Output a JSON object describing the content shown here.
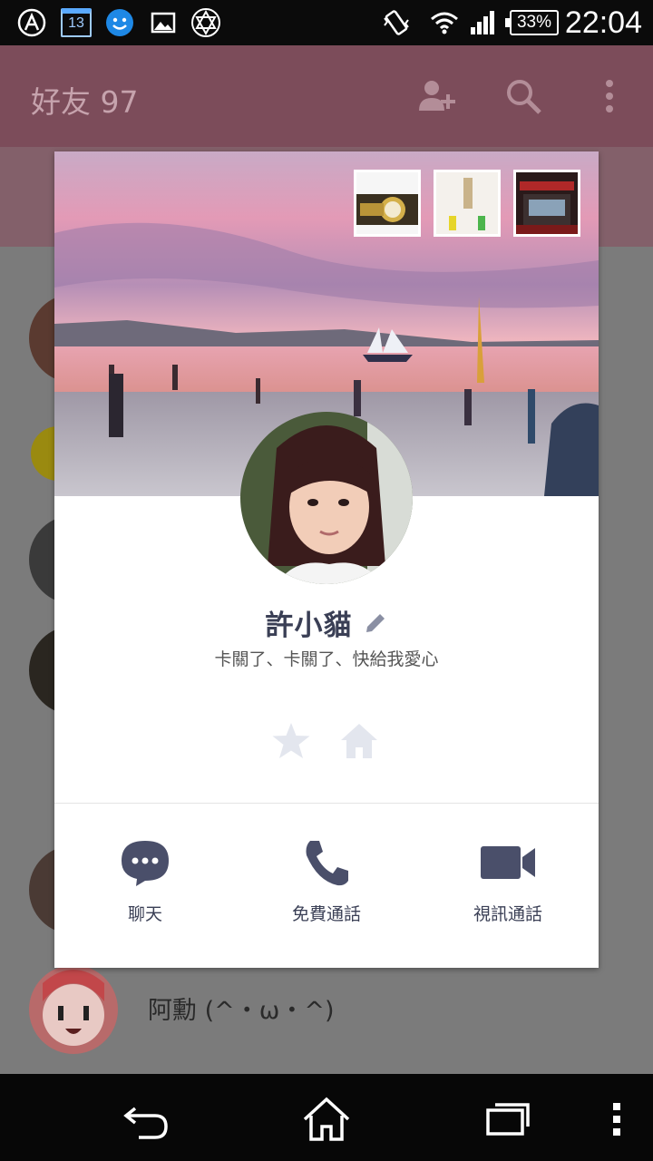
{
  "status_bar": {
    "time": "22:04",
    "battery": "33%",
    "calendar_day": "13",
    "icons": [
      "line-notification-icon",
      "calendar-icon",
      "messenger-icon",
      "gallery-icon",
      "star-of-david-icon",
      "vibrate-icon",
      "wifi-icon",
      "signal-icon",
      "battery-icon"
    ]
  },
  "app": {
    "title": "好友 97",
    "header_icons": [
      "add-friend-icon",
      "search-icon",
      "more-options-icon"
    ],
    "visible_friend_name": "阿勳 (^・ω・^)"
  },
  "profile": {
    "name": "許小貓",
    "status_message": "卡關了、卡關了、快給我愛心",
    "icons": [
      "edit-icon",
      "favorite-star-icon",
      "home-icon"
    ],
    "actions": [
      {
        "label": "聊天",
        "icon": "chat-bubble-icon"
      },
      {
        "label": "免費通話",
        "icon": "phone-icon"
      },
      {
        "label": "視訊通話",
        "icon": "video-camera-icon"
      }
    ]
  },
  "nav_bar": {
    "buttons": [
      "back-icon",
      "home-icon",
      "recent-apps-icon",
      "overflow-menu-icon"
    ]
  },
  "colors": {
    "header": "#7c4c5a",
    "overlay": "#7b7b7b",
    "accent_text": "#3a3f55",
    "icon_muted": "#e3e6ee"
  }
}
